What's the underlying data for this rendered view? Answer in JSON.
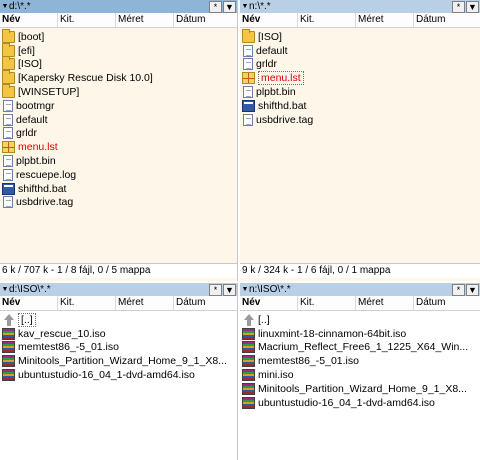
{
  "columns": {
    "name": "Név",
    "ext": "Kit.",
    "size": "Méret",
    "date": "Dátum"
  },
  "buttons": {
    "star": "*",
    "dropdown": "▼"
  },
  "panels": {
    "top_left": {
      "path": "d:\\*.*",
      "items": [
        {
          "name": "[boot]",
          "icon": "folder-icon"
        },
        {
          "name": "[efi]",
          "icon": "folder-icon"
        },
        {
          "name": "[ISO]",
          "icon": "folder-icon"
        },
        {
          "name": "[Kapersky Rescue Disk 10.0]",
          "icon": "folder-icon"
        },
        {
          "name": "[WINSETUP]",
          "icon": "folder-icon"
        },
        {
          "name": "bootmgr",
          "icon": "file-icon"
        },
        {
          "name": "default",
          "icon": "file-icon"
        },
        {
          "name": "grldr",
          "icon": "file-icon"
        },
        {
          "name": "menu.lst",
          "icon": "grid-file-icon",
          "color": "#e00000"
        },
        {
          "name": "plpbt.bin",
          "icon": "file-icon"
        },
        {
          "name": "rescuepe.log",
          "icon": "file-icon"
        },
        {
          "name": "shifthd.bat",
          "icon": "batch-file-icon"
        },
        {
          "name": "usbdrive.tag",
          "icon": "file-icon"
        }
      ],
      "status": "6 k / 707 k - 1 / 8 fájl, 0 / 5 mappa"
    },
    "top_right": {
      "path": "n:\\*.*",
      "items": [
        {
          "name": "[ISO]",
          "icon": "folder-icon"
        },
        {
          "name": "default",
          "icon": "file-icon"
        },
        {
          "name": "grldr",
          "icon": "file-icon"
        },
        {
          "name": "menu.lst",
          "icon": "grid-file-icon",
          "color": "#e00000",
          "selected": true
        },
        {
          "name": "plpbt.bin",
          "icon": "file-icon"
        },
        {
          "name": "shifthd.bat",
          "icon": "batch-file-icon"
        },
        {
          "name": "usbdrive.tag",
          "icon": "file-icon"
        }
      ],
      "status": "9 k / 324 k - 1 / 6 fájl, 0 / 1 mappa"
    },
    "bottom_left": {
      "path": "d:\\ISO\\*.*",
      "items": [
        {
          "name": "[..]",
          "icon": "up-folder-icon",
          "selected": true
        },
        {
          "name": "kav_rescue_10.iso",
          "icon": "iso-file-icon"
        },
        {
          "name": "memtest86_-5_01.iso",
          "icon": "iso-file-icon"
        },
        {
          "name": "Minitools_Partition_Wizard_Home_9_1_X8...",
          "icon": "iso-file-icon"
        },
        {
          "name": "ubuntustudio-16_04_1-dvd-amd64.iso",
          "icon": "iso-file-icon"
        }
      ]
    },
    "bottom_right": {
      "path": "n:\\ISO\\*.*",
      "items": [
        {
          "name": "[..]",
          "icon": "up-folder-icon"
        },
        {
          "name": "linuxmint-18-cinnamon-64bit.iso",
          "icon": "iso-file-icon"
        },
        {
          "name": "Macrium_Reflect_Free6_1_1225_X64_Win...",
          "icon": "iso-file-icon"
        },
        {
          "name": "memtest86_-5_01.iso",
          "icon": "iso-file-icon"
        },
        {
          "name": "mini.iso",
          "icon": "iso-file-icon"
        },
        {
          "name": "Minitools_Partition_Wizard_Home_9_1_X8...",
          "icon": "iso-file-icon"
        },
        {
          "name": "ubuntustudio-16_04_1-dvd-amd64.iso",
          "icon": "iso-file-icon"
        }
      ]
    }
  }
}
